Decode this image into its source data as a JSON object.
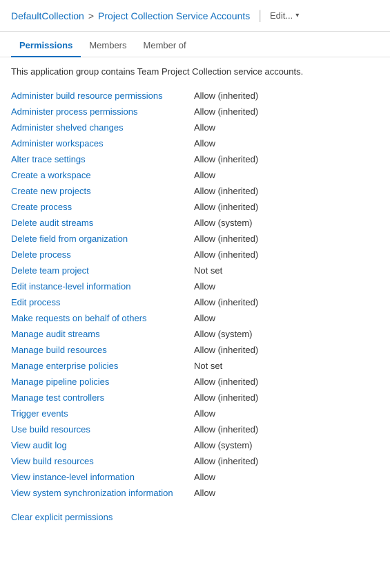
{
  "header": {
    "collection": "DefaultCollection",
    "separator": ">",
    "page": "Project Collection Service Accounts",
    "divider": "|",
    "edit_label": "Edit...",
    "dropdown_char": "▾"
  },
  "tabs": [
    {
      "id": "permissions",
      "label": "Permissions",
      "active": true
    },
    {
      "id": "members",
      "label": "Members",
      "active": false
    },
    {
      "id": "member-of",
      "label": "Member of",
      "active": false
    }
  ],
  "description": "This application group contains Team Project Collection service accounts.",
  "permissions": [
    {
      "name": "Administer build resource permissions",
      "value": "Allow (inherited)"
    },
    {
      "name": "Administer process permissions",
      "value": "Allow (inherited)"
    },
    {
      "name": "Administer shelved changes",
      "value": "Allow"
    },
    {
      "name": "Administer workspaces",
      "value": "Allow"
    },
    {
      "name": "Alter trace settings",
      "value": "Allow (inherited)"
    },
    {
      "name": "Create a workspace",
      "value": "Allow"
    },
    {
      "name": "Create new projects",
      "value": "Allow (inherited)"
    },
    {
      "name": "Create process",
      "value": "Allow (inherited)"
    },
    {
      "name": "Delete audit streams",
      "value": "Allow (system)"
    },
    {
      "name": "Delete field from organization",
      "value": "Allow (inherited)"
    },
    {
      "name": "Delete process",
      "value": "Allow (inherited)"
    },
    {
      "name": "Delete team project",
      "value": "Not set"
    },
    {
      "name": "Edit instance-level information",
      "value": "Allow"
    },
    {
      "name": "Edit process",
      "value": "Allow (inherited)"
    },
    {
      "name": "Make requests on behalf of others",
      "value": "Allow"
    },
    {
      "name": "Manage audit streams",
      "value": "Allow (system)"
    },
    {
      "name": "Manage build resources",
      "value": "Allow (inherited)"
    },
    {
      "name": "Manage enterprise policies",
      "value": "Not set"
    },
    {
      "name": "Manage pipeline policies",
      "value": "Allow (inherited)"
    },
    {
      "name": "Manage test controllers",
      "value": "Allow (inherited)"
    },
    {
      "name": "Trigger events",
      "value": "Allow"
    },
    {
      "name": "Use build resources",
      "value": "Allow (inherited)"
    },
    {
      "name": "View audit log",
      "value": "Allow (system)"
    },
    {
      "name": "View build resources",
      "value": "Allow (inherited)"
    },
    {
      "name": "View instance-level information",
      "value": "Allow"
    },
    {
      "name": "View system synchronization information",
      "value": "Allow"
    }
  ],
  "footer": {
    "clear_link": "Clear explicit permissions"
  }
}
